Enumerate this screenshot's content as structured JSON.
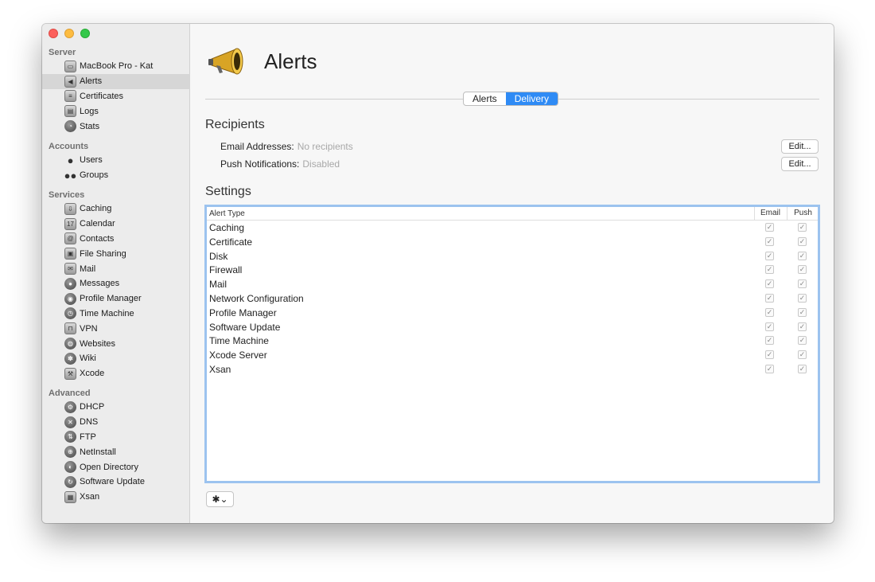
{
  "sidebar": {
    "sections": [
      {
        "header": "Server",
        "items": [
          {
            "label": "MacBook Pro - Kat",
            "icon": "laptop-icon"
          },
          {
            "label": "Alerts",
            "icon": "megaphone-icon",
            "selected": true
          },
          {
            "label": "Certificates",
            "icon": "certificate-icon"
          },
          {
            "label": "Logs",
            "icon": "logs-icon"
          },
          {
            "label": "Stats",
            "icon": "stats-icon"
          }
        ]
      },
      {
        "header": "Accounts",
        "items": [
          {
            "label": "Users",
            "icon": "user-icon"
          },
          {
            "label": "Groups",
            "icon": "groups-icon"
          }
        ]
      },
      {
        "header": "Services",
        "items": [
          {
            "label": "Caching",
            "icon": "caching-icon"
          },
          {
            "label": "Calendar",
            "icon": "calendar-icon"
          },
          {
            "label": "Contacts",
            "icon": "contacts-icon"
          },
          {
            "label": "File Sharing",
            "icon": "file-sharing-icon"
          },
          {
            "label": "Mail",
            "icon": "mail-icon"
          },
          {
            "label": "Messages",
            "icon": "messages-icon"
          },
          {
            "label": "Profile Manager",
            "icon": "profile-manager-icon"
          },
          {
            "label": "Time Machine",
            "icon": "time-machine-icon"
          },
          {
            "label": "VPN",
            "icon": "vpn-icon"
          },
          {
            "label": "Websites",
            "icon": "websites-icon"
          },
          {
            "label": "Wiki",
            "icon": "wiki-icon"
          },
          {
            "label": "Xcode",
            "icon": "xcode-icon"
          }
        ]
      },
      {
        "header": "Advanced",
        "items": [
          {
            "label": "DHCP",
            "icon": "dhcp-icon"
          },
          {
            "label": "DNS",
            "icon": "dns-icon"
          },
          {
            "label": "FTP",
            "icon": "ftp-icon"
          },
          {
            "label": "NetInstall",
            "icon": "netinstall-icon"
          },
          {
            "label": "Open Directory",
            "icon": "open-directory-icon"
          },
          {
            "label": "Software Update",
            "icon": "software-update-icon"
          },
          {
            "label": "Xsan",
            "icon": "xsan-icon"
          }
        ]
      }
    ]
  },
  "main": {
    "title": "Alerts",
    "tabs": [
      {
        "label": "Alerts",
        "active": false
      },
      {
        "label": "Delivery",
        "active": true
      }
    ],
    "recipients": {
      "heading": "Recipients",
      "email_label": "Email Addresses:",
      "email_value": "No recipients",
      "push_label": "Push Notifications:",
      "push_value": "Disabled",
      "edit_label": "Edit..."
    },
    "settings": {
      "heading": "Settings",
      "columns": {
        "type": "Alert Type",
        "email": "Email",
        "push": "Push"
      },
      "rows": [
        {
          "name": "Caching",
          "email": true,
          "push": true
        },
        {
          "name": "Certificate",
          "email": true,
          "push": true
        },
        {
          "name": "Disk",
          "email": true,
          "push": true
        },
        {
          "name": "Firewall",
          "email": true,
          "push": true
        },
        {
          "name": "Mail",
          "email": true,
          "push": true
        },
        {
          "name": "Network Configuration",
          "email": true,
          "push": true
        },
        {
          "name": "Profile Manager",
          "email": true,
          "push": true
        },
        {
          "name": "Software Update",
          "email": true,
          "push": true
        },
        {
          "name": "Time Machine",
          "email": true,
          "push": true
        },
        {
          "name": "Xcode Server",
          "email": true,
          "push": true
        },
        {
          "name": "Xsan",
          "email": true,
          "push": true
        }
      ]
    },
    "gear_glyph": "✱⌄"
  },
  "colors": {
    "accent": "#2f8bf5",
    "focus_ring": "#9cc3ef",
    "sidebar_bg": "#ececec",
    "selection": "#d6d6d6"
  }
}
